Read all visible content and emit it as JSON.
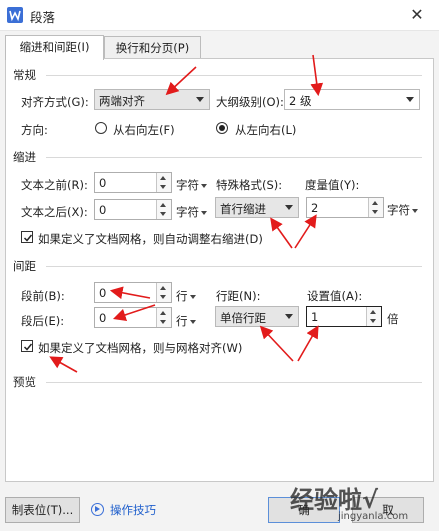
{
  "window": {
    "title": "段落",
    "close_glyph": "✕",
    "app_icon": "wps-writer-icon"
  },
  "tabs": [
    {
      "label": "缩进和间距(I)",
      "active": true
    },
    {
      "label": "换行和分页(P)",
      "active": false
    }
  ],
  "general": {
    "section": "常规",
    "alignment_label": "对齐方式(G):",
    "alignment_value": "两端对齐",
    "outline_label": "大纲级别(O):",
    "outline_value": "2 级",
    "direction_label": "方向:",
    "rtl_label": "从右向左(F)",
    "ltr_label": "从左向右(L)",
    "direction_selected": "ltr"
  },
  "indent": {
    "section": "缩进",
    "before_label": "文本之前(R):",
    "before_value": "0",
    "before_unit": "字符",
    "after_label": "文本之后(X):",
    "after_value": "0",
    "after_unit": "字符",
    "special_label": "特殊格式(S):",
    "special_value": "首行缩进",
    "measure_label": "度量值(Y):",
    "measure_value": "2",
    "measure_unit": "字符",
    "grid_checkbox": "如果定义了文档网格，则自动调整右缩进(D)",
    "grid_checked": true
  },
  "spacing": {
    "section": "间距",
    "before_label": "段前(B):",
    "before_value": "0",
    "before_unit": "行",
    "after_label": "段后(E):",
    "after_value": "0",
    "after_unit": "行",
    "line_label": "行距(N):",
    "line_value": "单倍行距",
    "set_label": "设置值(A):",
    "set_value": "1",
    "set_unit": "倍",
    "grid_checkbox": "如果定义了文档网格，则与网格对齐(W)",
    "grid_checked": true
  },
  "preview": {
    "section": "预览"
  },
  "footer": {
    "tabs_button": "制表位(T)...",
    "tips_link": "操作技巧",
    "ok_button": "确",
    "cancel_button": "取"
  },
  "watermark": {
    "text": "经验啦√",
    "url": "jingyanla.com"
  },
  "colors": {
    "accent": "#1f5fcc",
    "annotation": "#e21b1b"
  }
}
